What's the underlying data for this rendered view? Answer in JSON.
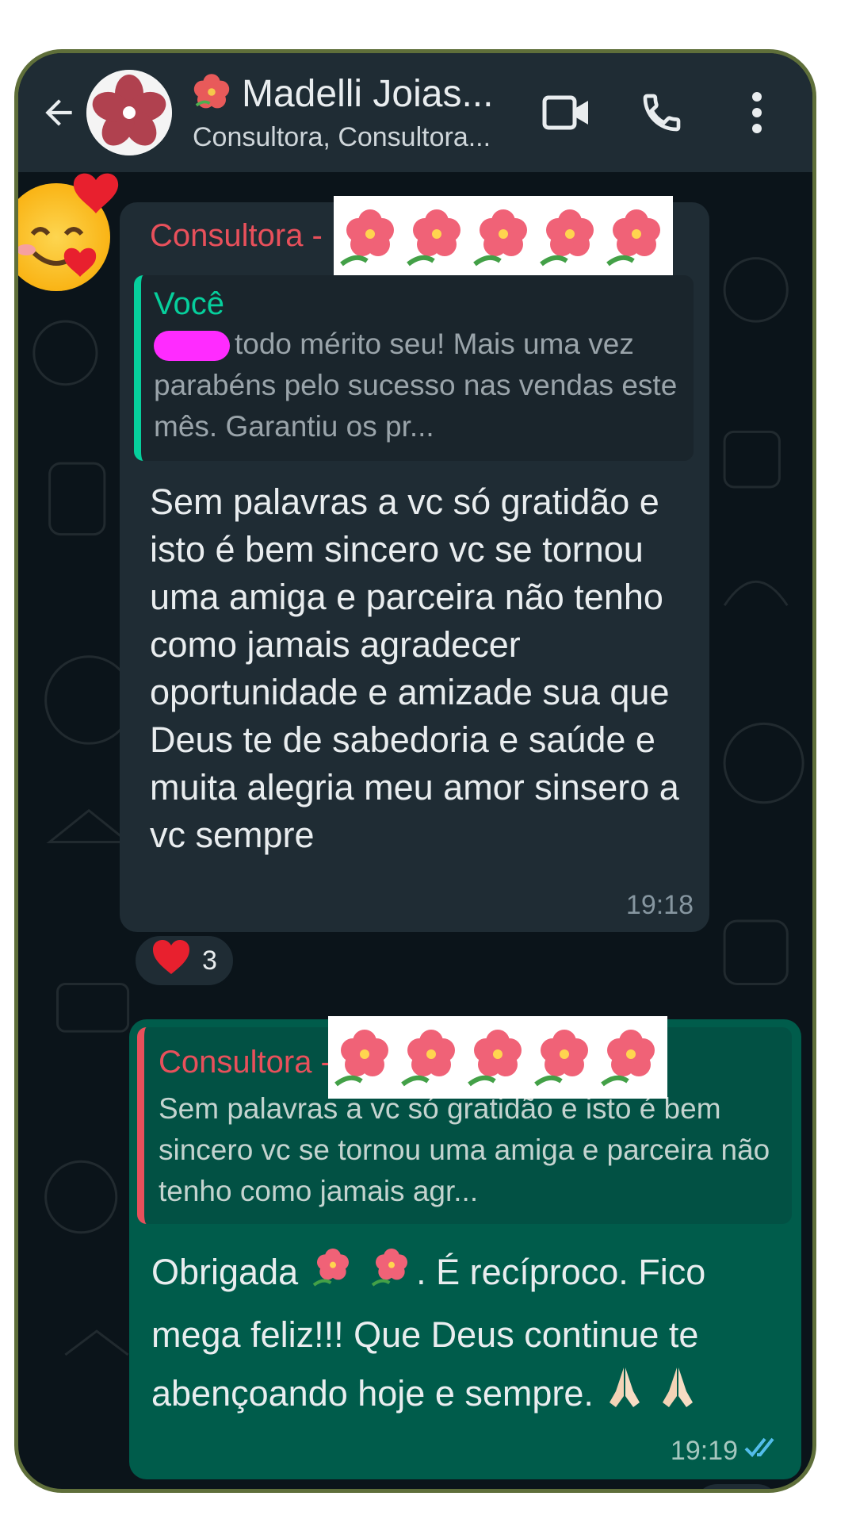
{
  "header": {
    "title": "Madelli Joias...",
    "subtitle": "Consultora, Consultora..."
  },
  "message_in": {
    "sender": "Consultora -",
    "quoted_name": "Você",
    "quoted_text": "todo mérito seu! Mais uma vez parabéns pelo sucesso nas vendas este mês. Garantiu os pr...",
    "body": "Sem palavras a vc só gratidão e isto é bem sincero vc se tornou uma amiga e parceira não tenho como jamais agradecer oportunidade e amizade sua que Deus te de sabedoria e saúde e muita alegria  meu amor sinsero a vc sempre",
    "time": "19:18",
    "reaction_count": "3"
  },
  "message_out": {
    "quoted_sender": "Consultora -",
    "quoted_text": "Sem palavras a vc só gratidão e isto é bem sincero vc se tornou uma amiga e parceira não tenho como jamais agr...",
    "body_part1": "Obrigada",
    "body_part2": ". É recíproco. Fico mega feliz!!! Que Deus continue te abençoando hoje e sempre.",
    "time": "19:19"
  },
  "colors": {
    "header_bg": "#1f2c34",
    "incoming_bubble": "#1f2c34",
    "outgoing_bubble": "#005c4b",
    "sender_name": "#e8505b",
    "quote_accent_you": "#06cf9c",
    "read_ticks": "#53bdeb"
  },
  "icons": [
    "back-arrow-icon",
    "video-call-icon",
    "phone-icon",
    "more-options-icon",
    "hibiscus-emoji",
    "heart-eyes-emoji",
    "heart-emoji",
    "praying-hands-emoji",
    "double-check-icon",
    "chevron-down-icon"
  ]
}
